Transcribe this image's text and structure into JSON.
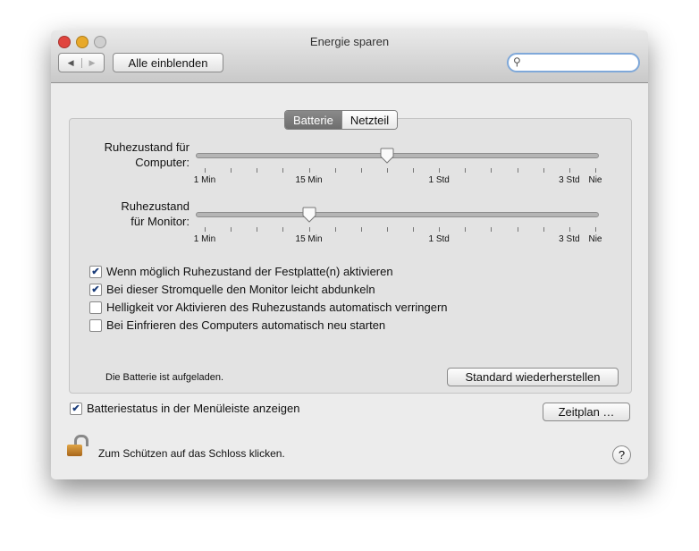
{
  "window": {
    "title": "Energie sparen"
  },
  "toolbar": {
    "back": "◀",
    "forward": "▶",
    "show_all": "Alle einblenden",
    "search_placeholder": ""
  },
  "tabs": [
    {
      "label": "Batterie",
      "selected": true
    },
    {
      "label": "Netzteil",
      "selected": false
    }
  ],
  "sliders": [
    {
      "label_line1": "Ruhezustand für",
      "label_line2": "Computer:",
      "value_tick": 7,
      "tick_count": 16
    },
    {
      "label_line1": "Ruhezustand",
      "label_line2": "für Monitor:",
      "value_tick": 4,
      "tick_count": 16
    }
  ],
  "tick_labels": [
    {
      "text": "1 Min",
      "tick": 0
    },
    {
      "text": "15 Min",
      "tick": 4
    },
    {
      "text": "1 Std",
      "tick": 9
    },
    {
      "text": "3 Std",
      "tick": 14
    },
    {
      "text": "Nie",
      "tick": 15
    }
  ],
  "options": [
    {
      "label": "Wenn möglich Ruhezustand der Festplatte(n) aktivieren",
      "checked": true
    },
    {
      "label": "Bei dieser Stromquelle den Monitor leicht abdunkeln",
      "checked": true
    },
    {
      "label": "Helligkeit vor Aktivieren des Ruhezustands automatisch verringern",
      "checked": false
    },
    {
      "label": "Bei Einfrieren des Computers automatisch neu starten",
      "checked": false
    }
  ],
  "status": "Die Batterie ist aufgeladen.",
  "restore_button": "Standard wiederherstellen",
  "battery_menu": {
    "label": "Batteriestatus in der Menüleiste anzeigen",
    "checked": true
  },
  "schedule_button": "Zeitplan …",
  "lock_text": "Zum Schützen auf das Schloss klicken.",
  "help": "?"
}
